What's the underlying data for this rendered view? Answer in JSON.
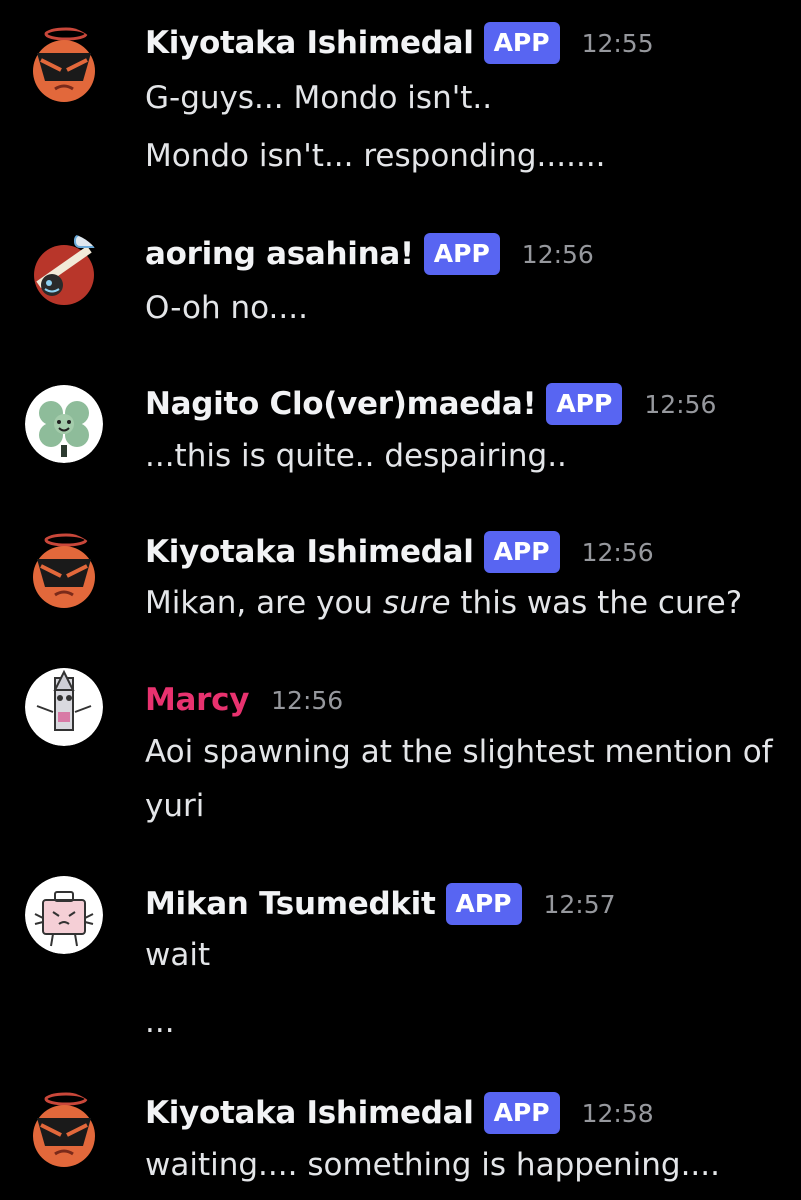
{
  "messages": [
    {
      "author": "Kiyotaka Ishimedal",
      "badge": "APP",
      "time": "12:55",
      "avatar": "kiyotaka-avatar",
      "lines": [
        "G-guys... Mondo isn't..",
        "Mondo isn't... responding......."
      ]
    },
    {
      "author": "aoring asahina!",
      "badge": "APP",
      "time": "12:56",
      "avatar": "aoi-avatar",
      "lines": [
        "O-oh no...."
      ]
    },
    {
      "author": "Nagito Clo(ver)maeda!",
      "badge": "APP",
      "time": "12:56",
      "avatar": "nagito-avatar",
      "lines": [
        "...this is quite.. despairing.."
      ]
    },
    {
      "author": "Kiyotaka Ishimedal",
      "badge": "APP",
      "time": "12:56",
      "avatar": "kiyotaka-avatar",
      "lines": [],
      "rich_line": {
        "before": "Mikan, are you ",
        "emphasis": "sure",
        "after": " this was the cure?"
      }
    },
    {
      "author": "Marcy",
      "author_color": "#e8326f",
      "time": "12:56",
      "avatar": "marcy-avatar",
      "lines": [
        "Aoi spawning at the slightest mention of",
        "yuri"
      ]
    },
    {
      "author": "Mikan Tsumedkit",
      "badge": "APP",
      "time": "12:57",
      "avatar": "mikan-avatar",
      "lines": [
        "wait",
        "..."
      ]
    },
    {
      "author": "Kiyotaka Ishimedal",
      "badge": "APP",
      "time": "12:58",
      "avatar": "kiyotaka-avatar",
      "lines": [
        "waiting.... something is happening...."
      ]
    }
  ],
  "colors": {
    "background": "#000000",
    "badge": "#5865f2",
    "timestamp": "#96989d",
    "marcy_name": "#e8326f"
  }
}
